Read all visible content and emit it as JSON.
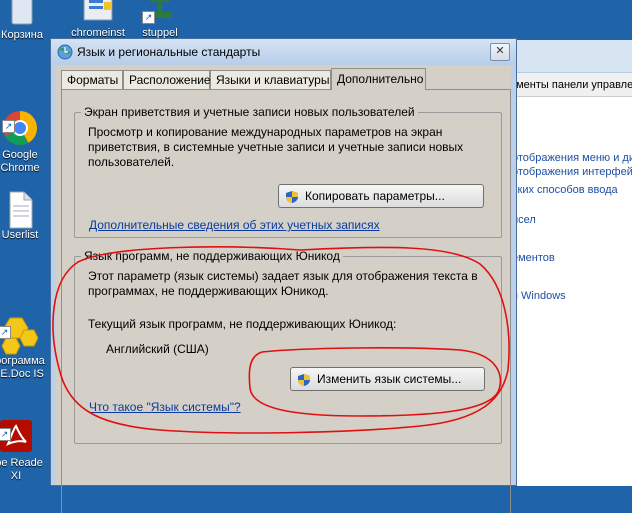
{
  "desktop": {
    "icons": [
      {
        "label": "Корзина"
      },
      {
        "label": "chromeinst"
      },
      {
        "label": "stuppel"
      },
      {
        "label": "Google\nChrome"
      },
      {
        "label": "Userlist"
      },
      {
        "label": "Программа\nM.E.Doc IS"
      },
      {
        "label": "obe Reade\nXI"
      }
    ]
  },
  "background_window": {
    "breadcrumb": "ементы панели управле",
    "links": [
      "отображения меню и ди",
      "отображения интерфейс",
      "ских способов ввода",
      "исел",
      "ементов",
      "я Windows"
    ]
  },
  "dialog": {
    "title": "Язык и региональные стандарты",
    "close_label": "✕",
    "tabs": [
      "Форматы",
      "Расположение",
      "Языки и клавиатуры",
      "Дополнительно"
    ],
    "active_tab": "Дополнительно",
    "welcome_group": {
      "title": "Экран приветствия и учетные записи новых пользователей",
      "description": "Просмотр и копирование международных параметров на экран приветствия, в системные учетные записи и учетные записи новых пользователей.",
      "copy_button": "Копировать параметры...",
      "link": "Дополнительные сведения об этих учетных записях"
    },
    "nonunicode_group": {
      "title": "Язык программ, не поддерживающих Юникод",
      "description": "Этот параметр (язык системы) задает язык для отображения текста в программах, не поддерживающих Юникод.",
      "current_label": "Текущий язык программ, не поддерживающих Юникод:",
      "current_value": "Английский (США)",
      "change_button": "Изменить язык системы...",
      "link": "Что такое \"Язык системы\"?"
    }
  },
  "colors": {
    "desktop": "#1f63a8",
    "dialog_face": "#d4d0c8",
    "annotation": "#e01010",
    "link": "#0b3a9e"
  }
}
